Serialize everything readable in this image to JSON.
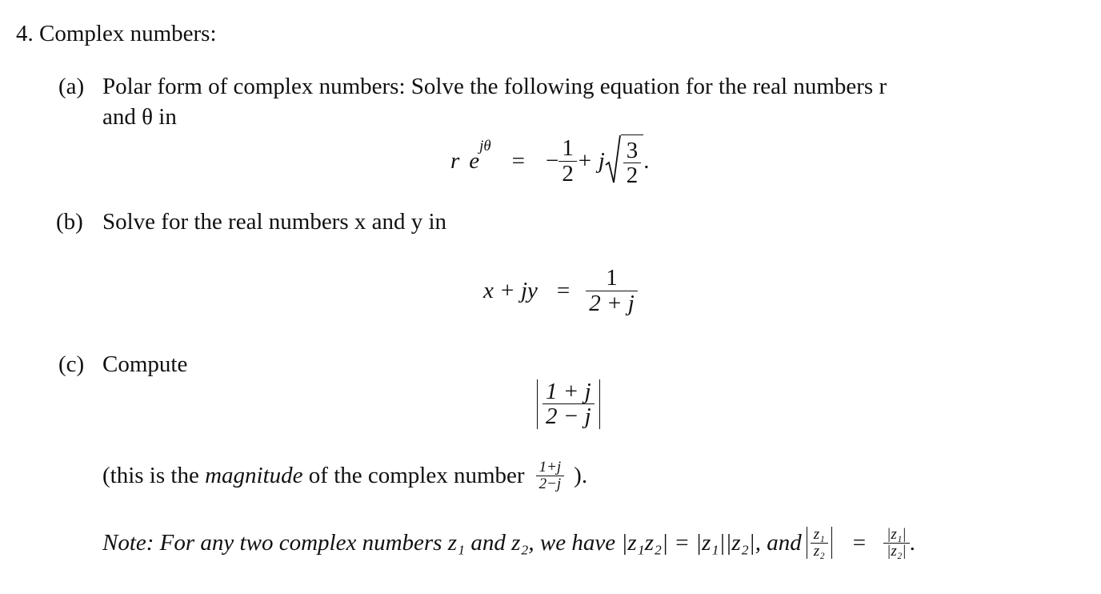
{
  "problem": {
    "number": "4.",
    "title": "Complex numbers:"
  },
  "part_a": {
    "label": "(a)",
    "text_line1": "Polar form of complex numbers: Solve the following equation for the real numbers r",
    "text_line2": "and θ in",
    "equation": {
      "lhs_r": "r",
      "lhs_e": "e",
      "lhs_exp": "jθ",
      "equals": "=",
      "minus": "−",
      "frac_num": "1",
      "frac_den": "2",
      "plus_j": "+ j",
      "sqrt_num": "3",
      "sqrt_den": "2",
      "period": "."
    }
  },
  "part_b": {
    "label": "(b)",
    "text": "Solve for the real numbers x and y in",
    "equation": {
      "lhs": "x + jy",
      "equals": "=",
      "num": "1",
      "den": "2 + j"
    }
  },
  "part_c": {
    "label": "(c)",
    "text": "Compute",
    "expression": {
      "num": "1 + j",
      "den": "2 − j"
    },
    "explanation_pre": "(this is the ",
    "explanation_em": "magnitude",
    "explanation_post": " of the complex number",
    "inline_num": "1+j",
    "inline_den": "2−j",
    "explanation_end": ")."
  },
  "note": {
    "text": "Note: For any two complex numbers z₁ and z₂, we have |z₁z₂| = |z₁||z₂|, and",
    "frac_num": "z₁",
    "frac_den": "z₂",
    "equals": "=",
    "rhs_num": "|z₁|",
    "rhs_den": "|z₂|",
    "period": "."
  }
}
